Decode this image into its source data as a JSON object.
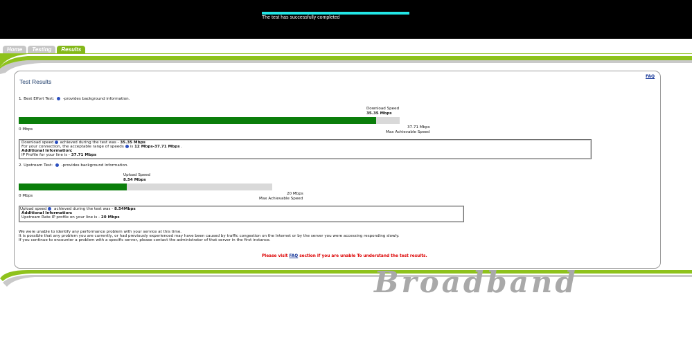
{
  "status": {
    "message": "The test has successfully completed",
    "progress": 1.0,
    "progress_color": "#22e6e6"
  },
  "tabs": [
    {
      "label": "Home",
      "active": false
    },
    {
      "label": "Testing",
      "active": false
    },
    {
      "label": "Results",
      "active": true
    }
  ],
  "results": {
    "title": "Test Results",
    "faq_label": "FAQ",
    "best_effort": {
      "heading": "1. Best Effort Test:",
      "heading_suffix": "-provides background information.",
      "speed_caption": "Download Speed",
      "speed_value": "35.35 Mbps",
      "min_label": "0 Mbps",
      "max_value": "37.71 Mbps",
      "max_caption": "Max Achievable Speed",
      "fill_fraction": 0.9374,
      "info": {
        "line1_prefix": "Download speed",
        "line1_mid": "achieved during the test was - ",
        "line1_value": "35.35 Mbps",
        "line2_prefix": "For your connection, the acceptable range of speeds",
        "line2_mid": "is ",
        "line2_value": "12 Mbps-37.71 Mbps",
        "line2_suffix": " .",
        "line3": "Additional Information:",
        "line4_prefix": "IP Profile for your line is - ",
        "line4_value": "37.71 Mbps"
      }
    },
    "upstream": {
      "heading": "2. Upstream Test:",
      "heading_suffix": "-provides background information.",
      "speed_caption": "Upload Speed",
      "speed_value": "8.54 Mbps",
      "min_label": "0 Mbps",
      "max_value": "20 Mbps",
      "max_caption": "Max Achievable Speed",
      "fill_fraction": 0.427,
      "info": {
        "line1_prefix": "Upload speed",
        "line1_mid": " achieved during the test was - ",
        "line1_value": "8.54Mbps",
        "line2": "Additional Information:",
        "line3_prefix": "Upstream Rate IP profile on your line is - ",
        "line3_value": "20 Mbps"
      }
    },
    "summary": [
      "We were unable to identify any performance problem with your service at this time.",
      "It is possible that any problem you are currently, or had previously experienced may have been caused by traffic congestion on the Internet or by the server you were accessing responding slowly.",
      "If you continue to encounter a problem with a specific server, please contact the administrator of that server in the first instance."
    ],
    "footer_prefix": "Please visit ",
    "footer_link": "FAQ",
    "footer_suffix": " section if you are unable To understand the test results."
  },
  "brand": "Broadband",
  "colors": {
    "bar_fill": "#0a7e0a",
    "bar_bg": "#d9d9d9",
    "tab_active": "#84b81a",
    "tab_inactive": "#c7c7c7",
    "accent_green": "#8ec21c",
    "footer_red": "#dd0000"
  }
}
